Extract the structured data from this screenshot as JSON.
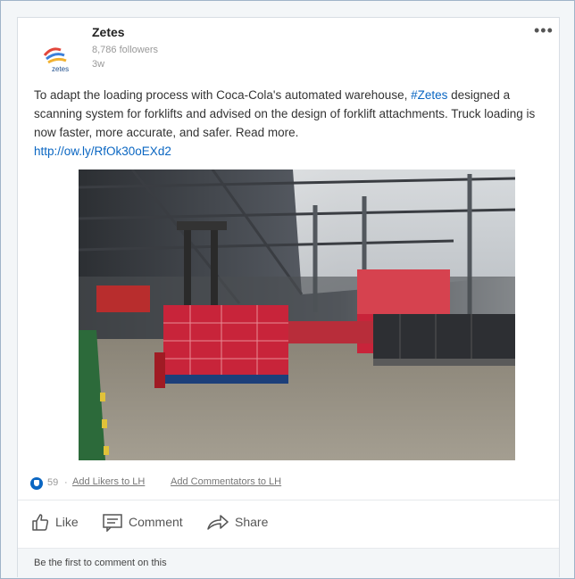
{
  "post": {
    "author": {
      "name": "Zetes",
      "followers": "8,786 followers",
      "time": "3w",
      "logo_text": "zetes"
    },
    "more_label": "•••",
    "text_before_tag": "To adapt the loading process with Coca-Cola's automated warehouse, ",
    "hashtag": "#Zetes",
    "text_after_tag": " designed a scanning system for forklifts and advised on the design of forklift attachments. Truck loading is now faster, more accurate, and safer. Read more.",
    "link": "http://ow.ly/RfOk30oEXd2"
  },
  "social": {
    "like_count": "59",
    "separator": "·",
    "add_likers": "Add Likers to LH",
    "add_commentators": "Add Commentators to LH"
  },
  "actions": {
    "like": "Like",
    "comment": "Comment",
    "share": "Share"
  },
  "comments": {
    "prompt": "Be the first to comment on this"
  },
  "colors": {
    "accent": "#0a66c2",
    "coca_cola_red": "#c8243a"
  }
}
